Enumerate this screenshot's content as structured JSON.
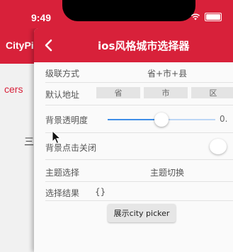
{
  "status_bar": {
    "time": "9:49"
  },
  "background_page": {
    "title": "CityPi",
    "red_text": "cers",
    "glyph": "三"
  },
  "app_bar": {
    "title": "ios风格城市选择器"
  },
  "rows": {
    "cascade": {
      "label": "级联方式",
      "value": "省+市+县"
    },
    "default_address": {
      "label": "默认地址",
      "province": "省",
      "city": "市",
      "district": "区"
    },
    "opacity": {
      "label": "背景透明度",
      "value": "0."
    },
    "tap_close": {
      "label": "背景点击关闭"
    },
    "theme": {
      "label": "主题选择",
      "value": "主题切换"
    },
    "result": {
      "label": "选择结果",
      "value": "{}"
    }
  },
  "show_button": {
    "label": "展示city picker"
  },
  "colors": {
    "accent": "#d8213a",
    "slider": "#3f8ee8"
  },
  "icons": [
    "back-arrow-icon",
    "wifi-icon",
    "battery-icon",
    "cursor-icon"
  ]
}
